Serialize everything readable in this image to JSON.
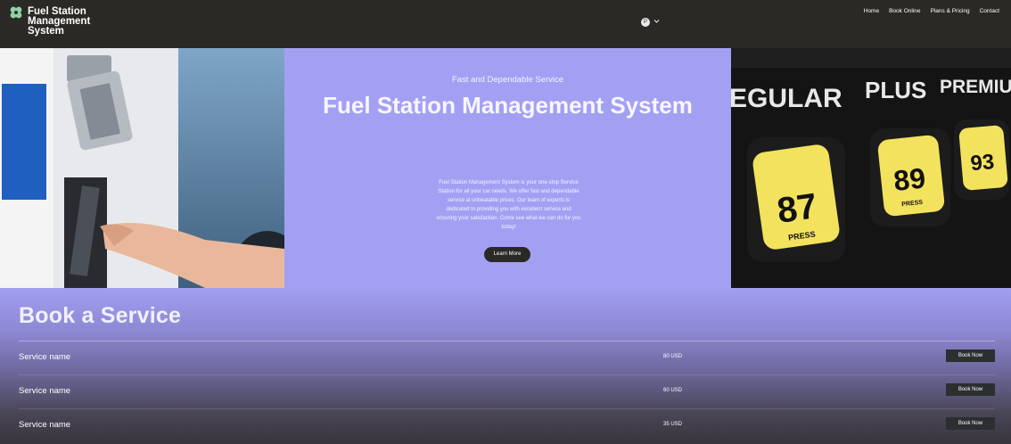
{
  "header": {
    "logo_text": "Fuel Station Management System",
    "avatar_initial": "P",
    "nav": [
      "Home",
      "Book Online",
      "Plans & Pricing",
      "Contact"
    ]
  },
  "hero": {
    "tagline": "Fast and Dependable Service",
    "title": "Fuel Station Management System",
    "description": "Fuel Station Management System is your one-stop Service Station for all your car needs. We offer fast and dependable service at unbeatable prices. Our team of experts is dedicated to providing you with excellent service and ensuring your satisfaction. Come see what we can do for you today!",
    "button": "Learn More",
    "pump_labels": [
      "EGULAR",
      "PLUS",
      "PREMIUM"
    ],
    "pump_octanes": [
      "87",
      "89",
      "93"
    ],
    "pump_press": "PRESS"
  },
  "booking": {
    "title": "Book a Service",
    "services": [
      {
        "name": "Service name",
        "price": "80 USD",
        "button": "Book Now"
      },
      {
        "name": "Service name",
        "price": "60 USD",
        "button": "Book Now"
      },
      {
        "name": "Service name",
        "price": "35 USD",
        "button": "Book Now"
      }
    ]
  },
  "colors": {
    "header_bg": "#2b2926",
    "hero_accent": "#a3a0f4",
    "logo_green": "#8fd3a6",
    "button_dark": "#2b2f30"
  }
}
